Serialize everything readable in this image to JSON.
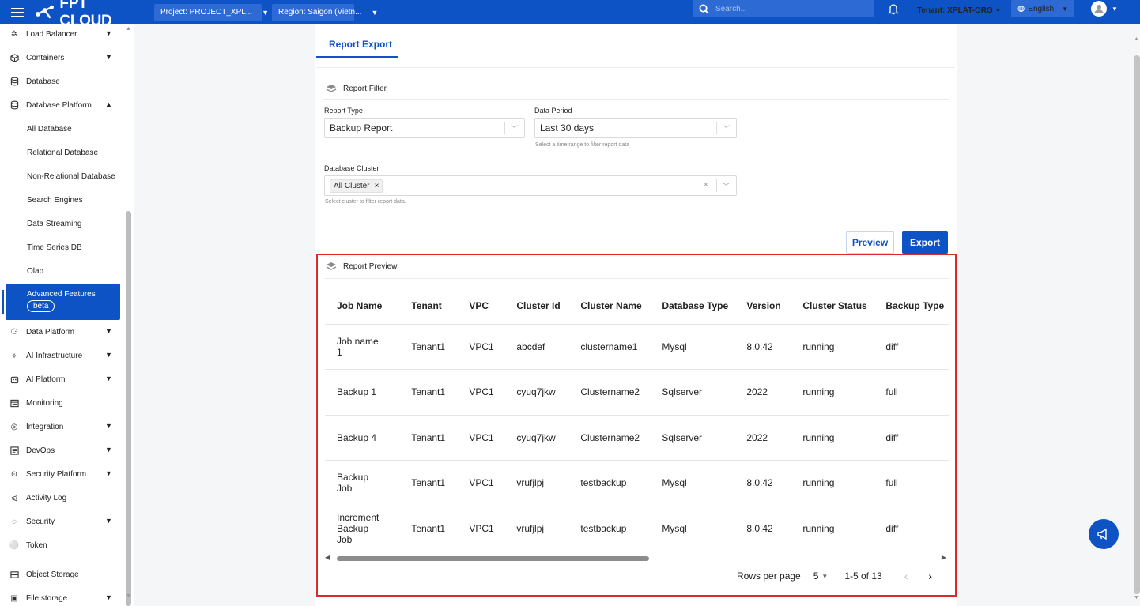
{
  "topbar": {
    "brand": "FPT CLOUD",
    "project": "Project: PROJECT_XPL...",
    "region": "Region: Saigon (Vietn...",
    "search_placeholder": "Search...",
    "tenant": "Tenant: XPLAT-ORG",
    "language": "English"
  },
  "sidebar": {
    "items": [
      {
        "label": "Load Balancer",
        "icon": "load-balancer-icon",
        "chevron": "down"
      },
      {
        "label": "Containers",
        "icon": "cube-icon",
        "chevron": "down"
      },
      {
        "label": "Database",
        "icon": "database-icon"
      },
      {
        "label": "Database Platform",
        "icon": "database-icon",
        "chevron": "up"
      }
    ],
    "sub_items": [
      "All Database",
      "Relational Database",
      "Non-Relational Database",
      "Search Engines",
      "Data Streaming",
      "Time Series DB",
      "Olap"
    ],
    "active": {
      "label": "Advanced Features",
      "badge": "beta"
    },
    "items2": [
      {
        "label": "Data Platform",
        "icon": "data-platform-icon",
        "chevron": "down"
      },
      {
        "label": "AI Infrastructure",
        "icon": "ai-infra-icon",
        "chevron": "down"
      },
      {
        "label": "AI Platform",
        "icon": "robot-icon",
        "chevron": "down"
      },
      {
        "label": "Monitoring",
        "icon": "monitor-icon"
      },
      {
        "label": "Integration",
        "icon": "integration-icon",
        "chevron": "down"
      },
      {
        "label": "DevOps",
        "icon": "devops-icon",
        "chevron": "down"
      },
      {
        "label": "Security Platform",
        "icon": "shield-icon",
        "chevron": "down"
      },
      {
        "label": "Activity Log",
        "icon": "activity-icon"
      },
      {
        "label": "Security",
        "icon": "security-icon",
        "chevron": "down"
      },
      {
        "label": "Token",
        "icon": "token-icon"
      }
    ],
    "items3": [
      {
        "label": "Object Storage",
        "icon": "storage-icon"
      },
      {
        "label": "File storage",
        "icon": "file-storage-icon",
        "chevron": "down"
      }
    ]
  },
  "main": {
    "tab": "Report Export",
    "filter": {
      "title": "Report Filter",
      "report_type_label": "Report Type",
      "report_type_value": "Backup Report",
      "data_period_label": "Data Period",
      "data_period_value": "Last 30 days",
      "data_period_hint": "Select a time range to filter report data",
      "cluster_label": "Database Cluster",
      "cluster_tag": "All Cluster",
      "cluster_hint": "Select cluster to filter report data."
    },
    "preview_button": "Preview",
    "export_button": "Export",
    "preview": {
      "title": "Report Preview",
      "columns": [
        "Job Name",
        "Tenant",
        "VPC",
        "Cluster Id",
        "Cluster Name",
        "Database Type",
        "Version",
        "Cluster Status",
        "Backup Type"
      ],
      "rows": [
        [
          "Job name 1",
          "Tenant1",
          "VPC1",
          "abcdef",
          "clustername1",
          "Mysql",
          "8.0.42",
          "running",
          "diff"
        ],
        [
          "Backup 1",
          "Tenant1",
          "VPC1",
          "cyuq7jkw",
          "Clustername2",
          "Sqlserver",
          "2022",
          "running",
          "full"
        ],
        [
          "Backup 4",
          "Tenant1",
          "VPC1",
          "cyuq7jkw",
          "Clustername2",
          "Sqlserver",
          "2022",
          "running",
          "diff"
        ],
        [
          "Backup Job",
          "Tenant1",
          "VPC1",
          "vrufjlpj",
          "testbackup",
          "Mysql",
          "8.0.42",
          "running",
          "full"
        ],
        [
          "Increment Backup Job",
          "Tenant1",
          "VPC1",
          "vrufjlpj",
          "testbackup",
          "Mysql",
          "8.0.42",
          "running",
          "diff"
        ]
      ],
      "pagination": {
        "rows_per_page_label": "Rows per page",
        "rows_per_page": "5",
        "range": "1-5 of 13"
      }
    }
  }
}
